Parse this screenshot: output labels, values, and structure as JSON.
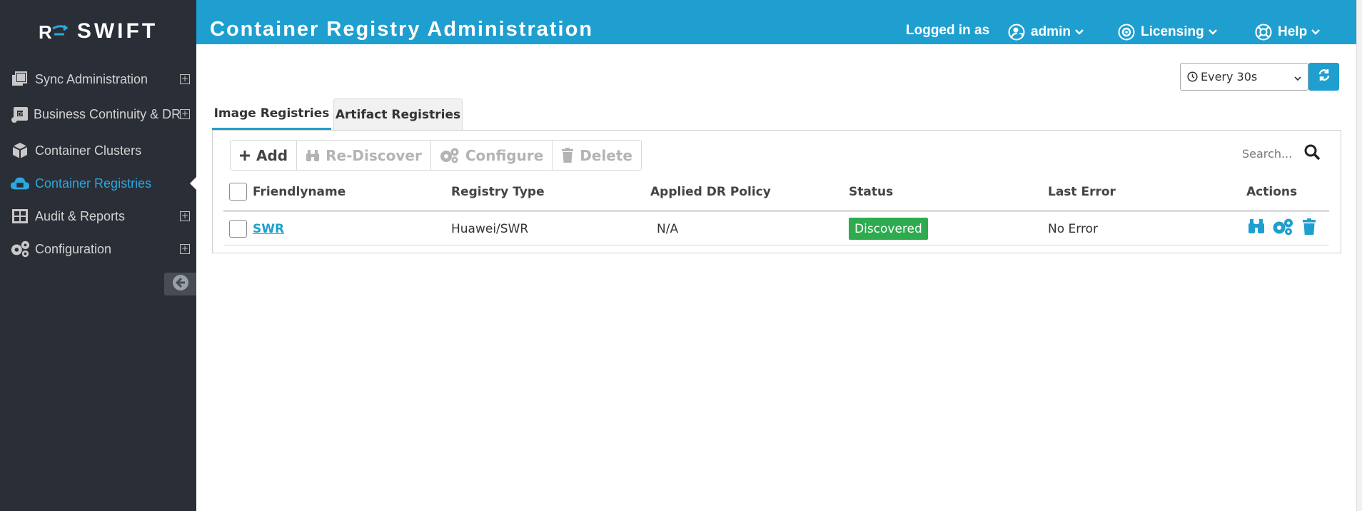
{
  "app": {
    "logo_text": "SWIFT"
  },
  "sidebar": {
    "items": [
      {
        "label": "Sync Administration",
        "icon": "copy-icon",
        "expandable": true,
        "active": false
      },
      {
        "label": "Business Continuity & DR",
        "icon": "dr-scroll-icon",
        "expandable": true,
        "active": false
      },
      {
        "label": "Container Clusters",
        "icon": "cube-icon",
        "expandable": false,
        "active": false
      },
      {
        "label": "Container Registries",
        "icon": "cloud-icon",
        "expandable": false,
        "active": true
      },
      {
        "label": "Audit & Reports",
        "icon": "grid-icon",
        "expandable": true,
        "active": false
      },
      {
        "label": "Configuration",
        "icon": "gears-icon",
        "expandable": true,
        "active": false
      }
    ],
    "collapse_icon": "arrow-left-circle-icon"
  },
  "header": {
    "title": "Container Registry Administration",
    "logged_in_label": "Logged in as",
    "user": "admin",
    "licensing": "Licensing",
    "help": "Help"
  },
  "refresh": {
    "interval": "Every 30s"
  },
  "tabs": [
    {
      "label": "Image Registries",
      "active": true
    },
    {
      "label": "Artifact Registries",
      "active": false
    }
  ],
  "toolbar": {
    "add": "Add",
    "rediscover": "Re-Discover",
    "configure": "Configure",
    "delete": "Delete"
  },
  "search": {
    "placeholder": "Search..."
  },
  "table": {
    "columns": [
      "Friendlyname",
      "Registry Type",
      "Applied DR Policy",
      "Status",
      "Last Error",
      "Actions"
    ],
    "rows": [
      {
        "friendlyname": "SWR",
        "registry_type": "Huawei/SWR",
        "dr_policy": "N/A",
        "status": "Discovered",
        "last_error": "No Error"
      }
    ]
  },
  "colors": {
    "accent": "#1f9fcf",
    "sidebar_bg": "#2a2e36",
    "status_ok": "#2eab4f"
  }
}
